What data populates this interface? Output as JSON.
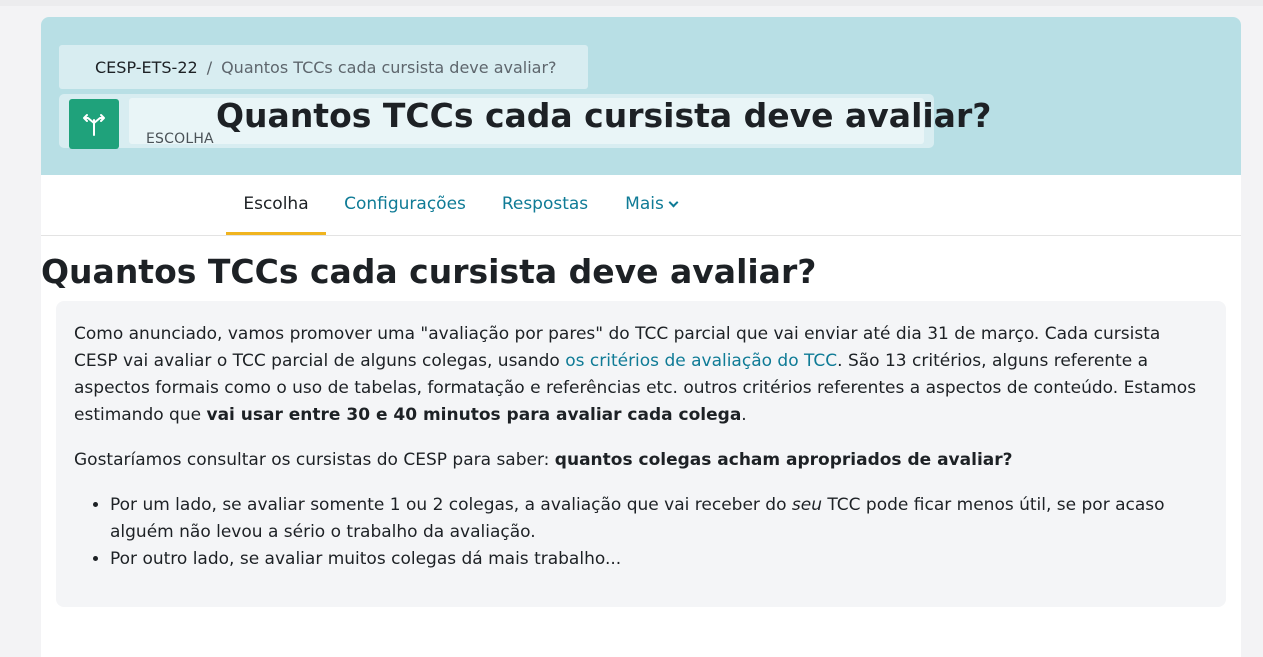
{
  "breadcrumb": {
    "course": "CESP-ETS-22",
    "separator": "/",
    "current": "Quantos TCCs cada cursista deve avaliar?"
  },
  "header": {
    "module_type": "ESCOLHA",
    "title": "Quantos TCCs cada cursista deve avaliar?",
    "icon": "choice-signpost-icon",
    "icon_bg": "#1fa27b",
    "banner_color": "#b8dfe5"
  },
  "tabs": [
    {
      "label": "Escolha",
      "active": true
    },
    {
      "label": "Configurações",
      "active": false
    },
    {
      "label": "Respostas",
      "active": false
    },
    {
      "label": "Mais",
      "active": false,
      "dropdown": true
    }
  ],
  "page_title": "Quantos TCCs cada cursista deve avaliar?",
  "intro": {
    "p1_a": "Como anunciado, vamos promover uma \"avaliação por pares\" do TCC parcial que vai enviar até dia 31 de março.  Cada cursista CESP vai avaliar o TCC parcial de alguns colegas, usando ",
    "p1_link": "os critérios de avaliação do TCC",
    "p1_b": ". São 13 critérios, alguns referente a aspectos formais como o uso de tabelas, formatação e referências etc. outros critérios referentes a aspectos de conteúdo. Estamos estimando que ",
    "p1_bold": "vai usar entre 30 e 40 minutos para avaliar cada colega",
    "p1_c": ".",
    "p2_a": "Gostaríamos consultar os cursistas do CESP para saber: ",
    "p2_bold": "quantos colegas acham apropriados de avaliar?",
    "li1_a": "Por um lado, se avaliar somente 1 ou 2 colegas, a avaliação que vai receber do ",
    "li1_em": "seu",
    "li1_b": " TCC  pode ficar menos útil, se por acaso alguém não levou a sério o trabalho da avaliação.",
    "li2": "Por outro lado, se avaliar muitos colegas dá mais trabalho..."
  },
  "colors": {
    "link": "#0f7b96",
    "active_tab_underline": "#f0b41f"
  }
}
